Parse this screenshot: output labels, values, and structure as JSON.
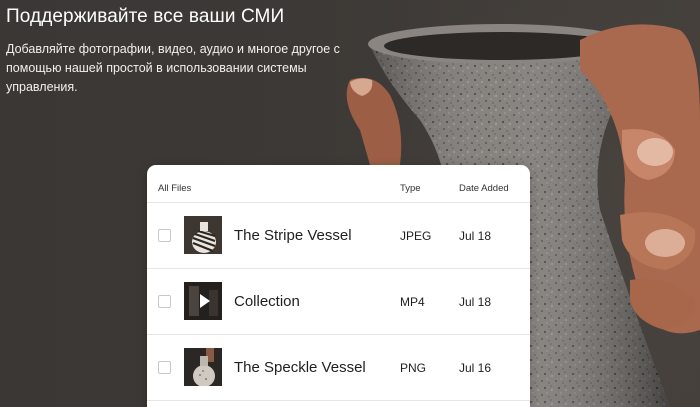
{
  "hero": {
    "title": "Поддерживайте все ваши СМИ",
    "description": "Добавляйте фотографии, видео, аудио и многое другое с помощью нашей простой в использовании системы управления."
  },
  "files_table": {
    "columns": {
      "name": "All Files",
      "type": "Type",
      "date": "Date Added"
    },
    "rows": [
      {
        "name": "The Stripe Vessel",
        "type": "JPEG",
        "date": "Jul 18",
        "thumbnail": "striped-vase-image"
      },
      {
        "name": "Collection",
        "type": "MP4",
        "date": "Jul 18",
        "thumbnail": "video-play-thumbnail"
      },
      {
        "name": "The Speckle Vessel",
        "type": "PNG",
        "date": "Jul 16",
        "thumbnail": "speckled-vase-image"
      }
    ]
  },
  "colors": {
    "background": "#3a3634",
    "card": "#ffffff",
    "text_dark": "#1f1f1f",
    "text_light": "#ffffff"
  }
}
